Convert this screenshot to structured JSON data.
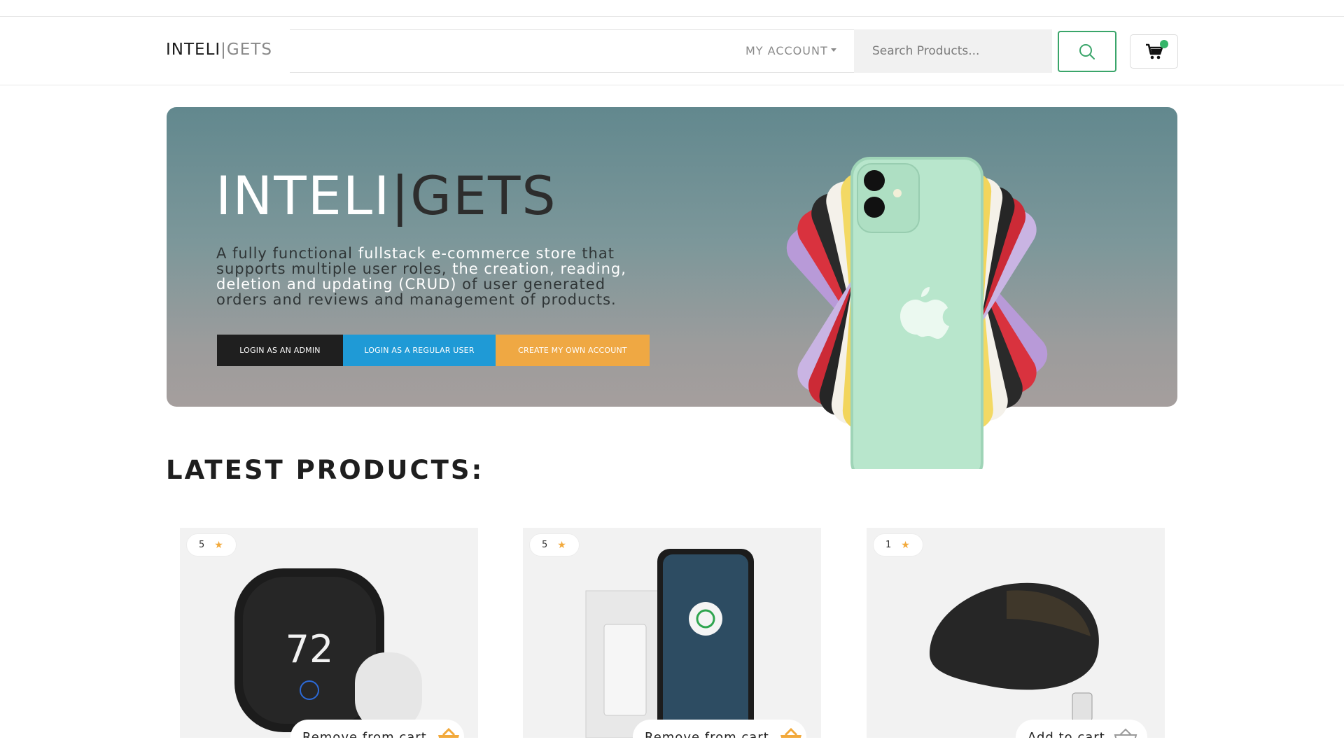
{
  "brand": {
    "main": "INTELI",
    "sep": "|",
    "light": "GETS"
  },
  "nav": {
    "account_label": "MY ACCOUNT"
  },
  "search": {
    "placeholder": "Search Products..."
  },
  "hero": {
    "title_main": "INTELI",
    "title_sep": "|",
    "title_dark": "GETS",
    "desc_1": "A fully functional ",
    "desc_2": "fullstack e-commerce store",
    "desc_3": " that supports multiple user roles, ",
    "desc_4": "the creation, reading, deletion and updating (CRUD)",
    "desc_5": " of user generated orders and reviews and management of products.",
    "btn_admin": "LOGIN AS AN ADMIN",
    "btn_user": "LOGIN AS A REGULAR USER",
    "btn_create": "CREATE MY OWN ACCOUNT"
  },
  "section": {
    "title": "LATEST PRODUCTS:"
  },
  "products": [
    {
      "rating": "5",
      "cart_label": "Remove from cart"
    },
    {
      "rating": "5",
      "cart_label": "Remove from cart"
    },
    {
      "rating": "1",
      "cart_label": "Add to cart"
    }
  ],
  "colors": {
    "accent_green": "#3aa56a",
    "admin": "#1f1f1f",
    "user": "#1f9ad6",
    "create": "#efa843",
    "star": "#f2a93b"
  },
  "icons": {
    "search": "search-icon",
    "cart": "shopping-cart-icon",
    "star": "star-icon",
    "basket": "basket-icon"
  }
}
